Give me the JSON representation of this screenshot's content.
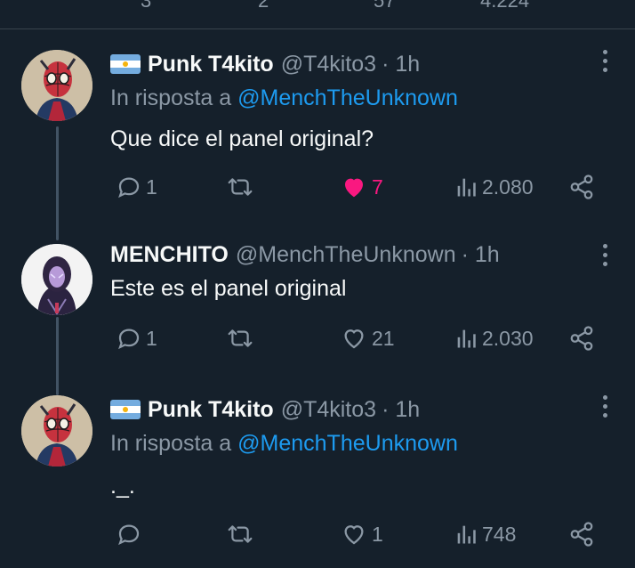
{
  "top_fragments": [
    "3",
    "2",
    "57",
    "4.224"
  ],
  "tweets": [
    {
      "name": "Punk T4kito",
      "handle": "@T4kito3",
      "time": "· 1h",
      "reply_prefix": "In risposta a",
      "reply_mention": "@MenchTheUnknown",
      "text": "Que dice el panel original?",
      "replies": "1",
      "retweets": "",
      "likes": "7",
      "views": "2.080",
      "liked": true
    },
    {
      "name": "MENCHITO",
      "handle": "@MenchTheUnknown",
      "time": "· 1h",
      "text": "Este es el panel original",
      "replies": "1",
      "retweets": "",
      "likes": "21",
      "views": "2.030",
      "liked": false
    },
    {
      "name": "Punk T4kito",
      "handle": "@T4kito3",
      "time": "· 1h",
      "reply_prefix": "In risposta a",
      "reply_mention": "@MenchTheUnknown",
      "text": "._.",
      "replies": "",
      "retweets": "",
      "likes": "1",
      "views": "748",
      "liked": false
    }
  ],
  "colors": {
    "background": "#15202b",
    "text": "#f7f9f9",
    "muted": "#8b98a5",
    "link": "#1d9bf0",
    "like": "#f91880",
    "divider": "#38444d",
    "thread_line": "#425364"
  },
  "icons": {
    "reply": "speech-bubble-icon",
    "retweet": "retweet-arrows-icon",
    "like": "heart-icon",
    "views": "bar-chart-icon",
    "share": "share-nodes-icon",
    "more": "vertical-dots-icon"
  }
}
